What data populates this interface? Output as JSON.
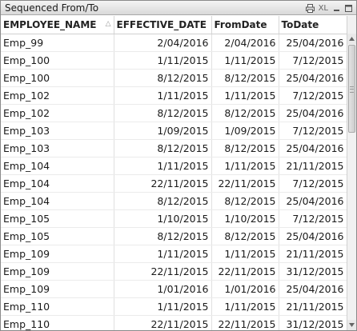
{
  "window": {
    "title": "Sequenced From/To",
    "xl_label": "XL"
  },
  "icons": {
    "print": "print-icon",
    "minimize": "minimize-icon",
    "maximize": "maximize-icon"
  },
  "table": {
    "columns": [
      "EMPLOYEE_NAME",
      "EFFECTIVE_DATE",
      "FromDate",
      "ToDate"
    ],
    "sort_indicator": "△",
    "rows": [
      [
        "Emp_99",
        "2/04/2016",
        "2/04/2016",
        "25/04/2016"
      ],
      [
        "Emp_100",
        "1/11/2015",
        "1/11/2015",
        "7/12/2015"
      ],
      [
        "Emp_100",
        "8/12/2015",
        "8/12/2015",
        "25/04/2016"
      ],
      [
        "Emp_102",
        "1/11/2015",
        "1/11/2015",
        "7/12/2015"
      ],
      [
        "Emp_102",
        "8/12/2015",
        "8/12/2015",
        "25/04/2016"
      ],
      [
        "Emp_103",
        "1/09/2015",
        "1/09/2015",
        "7/12/2015"
      ],
      [
        "Emp_103",
        "8/12/2015",
        "8/12/2015",
        "25/04/2016"
      ],
      [
        "Emp_104",
        "1/11/2015",
        "1/11/2015",
        "21/11/2015"
      ],
      [
        "Emp_104",
        "22/11/2015",
        "22/11/2015",
        "7/12/2015"
      ],
      [
        "Emp_104",
        "8/12/2015",
        "8/12/2015",
        "25/04/2016"
      ],
      [
        "Emp_105",
        "1/10/2015",
        "1/10/2015",
        "7/12/2015"
      ],
      [
        "Emp_105",
        "8/12/2015",
        "8/12/2015",
        "25/04/2016"
      ],
      [
        "Emp_109",
        "1/11/2015",
        "1/11/2015",
        "21/11/2015"
      ],
      [
        "Emp_109",
        "22/11/2015",
        "22/11/2015",
        "31/12/2015"
      ],
      [
        "Emp_109",
        "1/01/2016",
        "1/01/2016",
        "25/04/2016"
      ],
      [
        "Emp_110",
        "1/11/2015",
        "1/11/2015",
        "21/11/2015"
      ],
      [
        "Emp_110",
        "22/11/2015",
        "22/11/2015",
        "31/12/2015"
      ]
    ]
  }
}
